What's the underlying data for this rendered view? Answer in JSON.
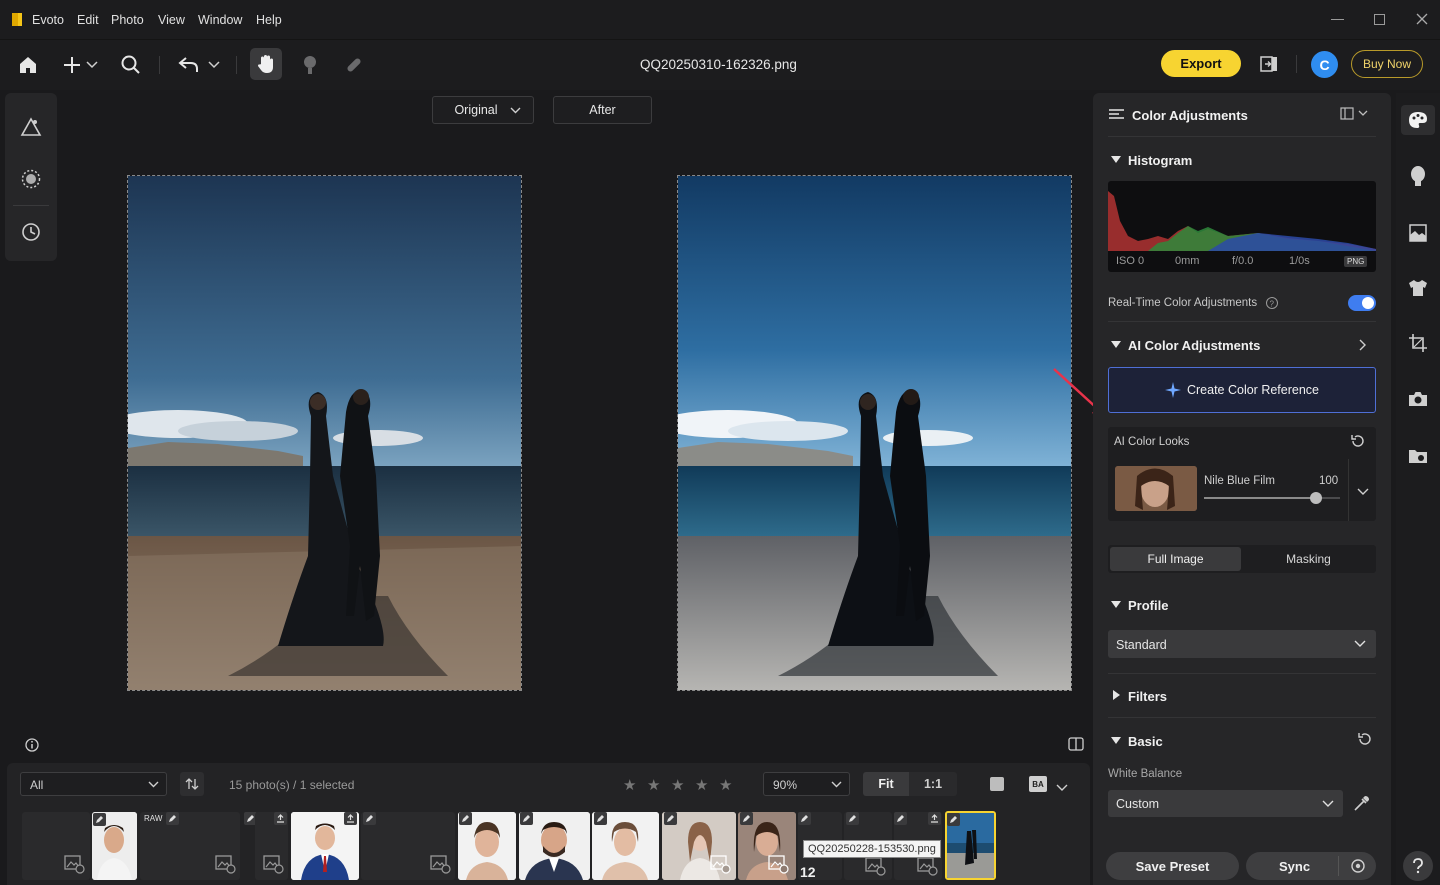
{
  "app": {
    "name": "Evoto",
    "file_name": "QQ20250310-162326.png"
  },
  "menu": [
    "Edit",
    "Photo",
    "View",
    "Window",
    "Help"
  ],
  "toolbar": {
    "export_label": "Export",
    "avatar_letter": "C",
    "buy_label": "Buy Now"
  },
  "view_modes": {
    "original_label": "Original",
    "after_label": "After"
  },
  "panel": {
    "title": "Color Adjustments",
    "histogram": {
      "title": "Histogram",
      "meta": [
        "ISO 0",
        "0mm",
        "f/0.0",
        "1/0s"
      ],
      "format_badge": "PNG"
    },
    "realtime_label": "Real-Time Color Adjustments",
    "realtime_enabled": true,
    "ai_section_title": "AI Color Adjustments",
    "create_ref_label": "Create Color Reference",
    "looks_label": "AI Color Looks",
    "look": {
      "name": "Nile Blue Film",
      "value": "100",
      "amount": 0.82
    },
    "scope_tabs": [
      "Full Image",
      "Masking"
    ],
    "scope_active": "Full Image",
    "profile": {
      "title": "Profile",
      "value": "Standard"
    },
    "filters_title": "Filters",
    "basic": {
      "title": "Basic",
      "wb_label": "White Balance",
      "wb_value": "Custom"
    },
    "save_preset_label": "Save Preset",
    "sync_label": "Sync"
  },
  "filmstrip": {
    "filter_value": "All",
    "count_text": "15 photo(s) / 1 selected",
    "zoom_value": "90%",
    "fit_label": "Fit",
    "one_to_one_label": "1:1",
    "ba_label": "BA",
    "raw_badge": "RAW",
    "tooltip": "QQ20250228-153530.png",
    "badge_count": "12"
  },
  "colors": {
    "accent_yellow": "#f7d431",
    "accent_blue": "#3f7df0",
    "panel_bg": "#262628",
    "app_bg": "#1a1a1c"
  }
}
